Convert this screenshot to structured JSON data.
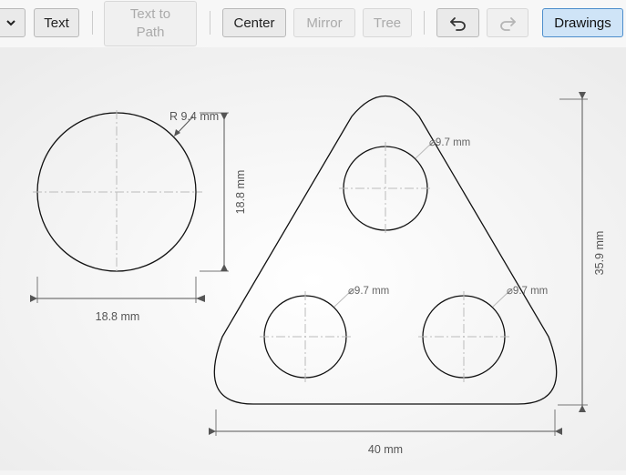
{
  "toolbar": {
    "text_label": "Text",
    "text_to_path_line1": "Text to",
    "text_to_path_line2": "Path",
    "center_label": "Center",
    "mirror_label": "Mirror",
    "tree_label": "Tree",
    "drawings_label": "Drawings",
    "dropdown_icon": "chevron-down-icon",
    "undo_icon": "undo-icon",
    "redo_icon": "redo-icon"
  },
  "drawing": {
    "circle_radius_label": "R 9.4 mm",
    "circle_height_label": "18.8 mm",
    "circle_width_label": "18.8 mm",
    "triangle_hole_top_label": "⌀9.7 mm",
    "triangle_hole_left_label": "⌀9.7 mm",
    "triangle_hole_right_label": "⌀9.7 mm",
    "triangle_height_label": "35.9 mm",
    "triangle_width_label": "40 mm"
  }
}
